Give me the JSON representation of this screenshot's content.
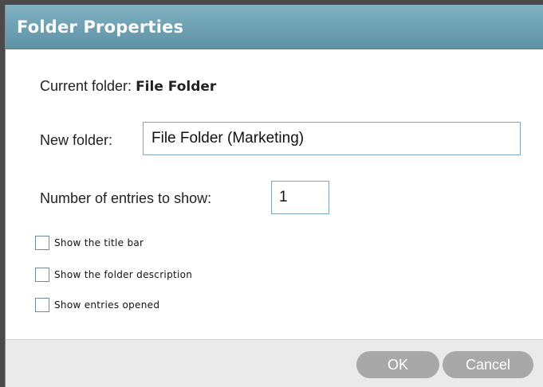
{
  "dialog": {
    "title": "Folder Properties"
  },
  "current_folder": {
    "label": "Current folder: ",
    "value": "File Folder"
  },
  "new_folder": {
    "label": "New folder:",
    "value": "File Folder (Marketing)"
  },
  "entries": {
    "label": "Number of entries to show:",
    "value": "1"
  },
  "options": [
    {
      "label": "Show the title bar",
      "checked": false
    },
    {
      "label": "Show the folder description",
      "checked": false
    },
    {
      "label": "Show entries opened",
      "checked": false
    }
  ],
  "buttons": {
    "ok": "OK",
    "cancel": "Cancel"
  },
  "colors": {
    "titlebar": "#6a9fb2",
    "button": "#a8a8a8",
    "input_border": "#7ea6c6"
  }
}
